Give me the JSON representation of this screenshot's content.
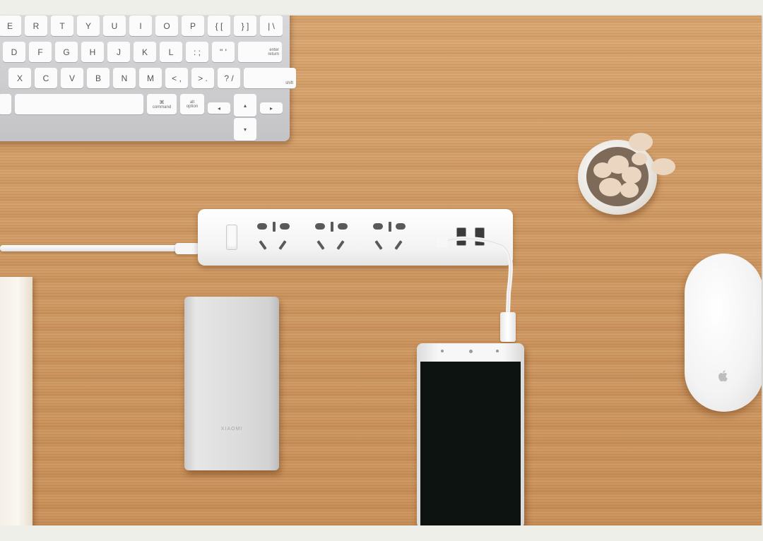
{
  "keyboard": {
    "row1": [
      "E",
      "R",
      "T",
      "Y",
      "U",
      "I",
      "O",
      "P",
      "{ [",
      "} ]",
      "| \\"
    ],
    "row2": [
      "D",
      "F",
      "G",
      "H",
      "J",
      "K",
      "L",
      ": ;",
      "\" '"
    ],
    "row2_return": "return",
    "row2_return_sub": "enter",
    "row3": [
      "X",
      "C",
      "V",
      "B",
      "N",
      "M",
      "< ,",
      "> .",
      "? /"
    ],
    "row3_shift": "shift",
    "row4_command_symbol": "⌘",
    "row4_command": "command",
    "row4_option_symbol": "alt",
    "row4_option": "option",
    "arrows": [
      "◂",
      "▴",
      "▾",
      "▸"
    ]
  },
  "powerbank": {
    "label": "XIAOMI"
  },
  "colors": {
    "desk": "#cf9862",
    "strip": "#f5f5f5",
    "screen": "#0c1311"
  }
}
